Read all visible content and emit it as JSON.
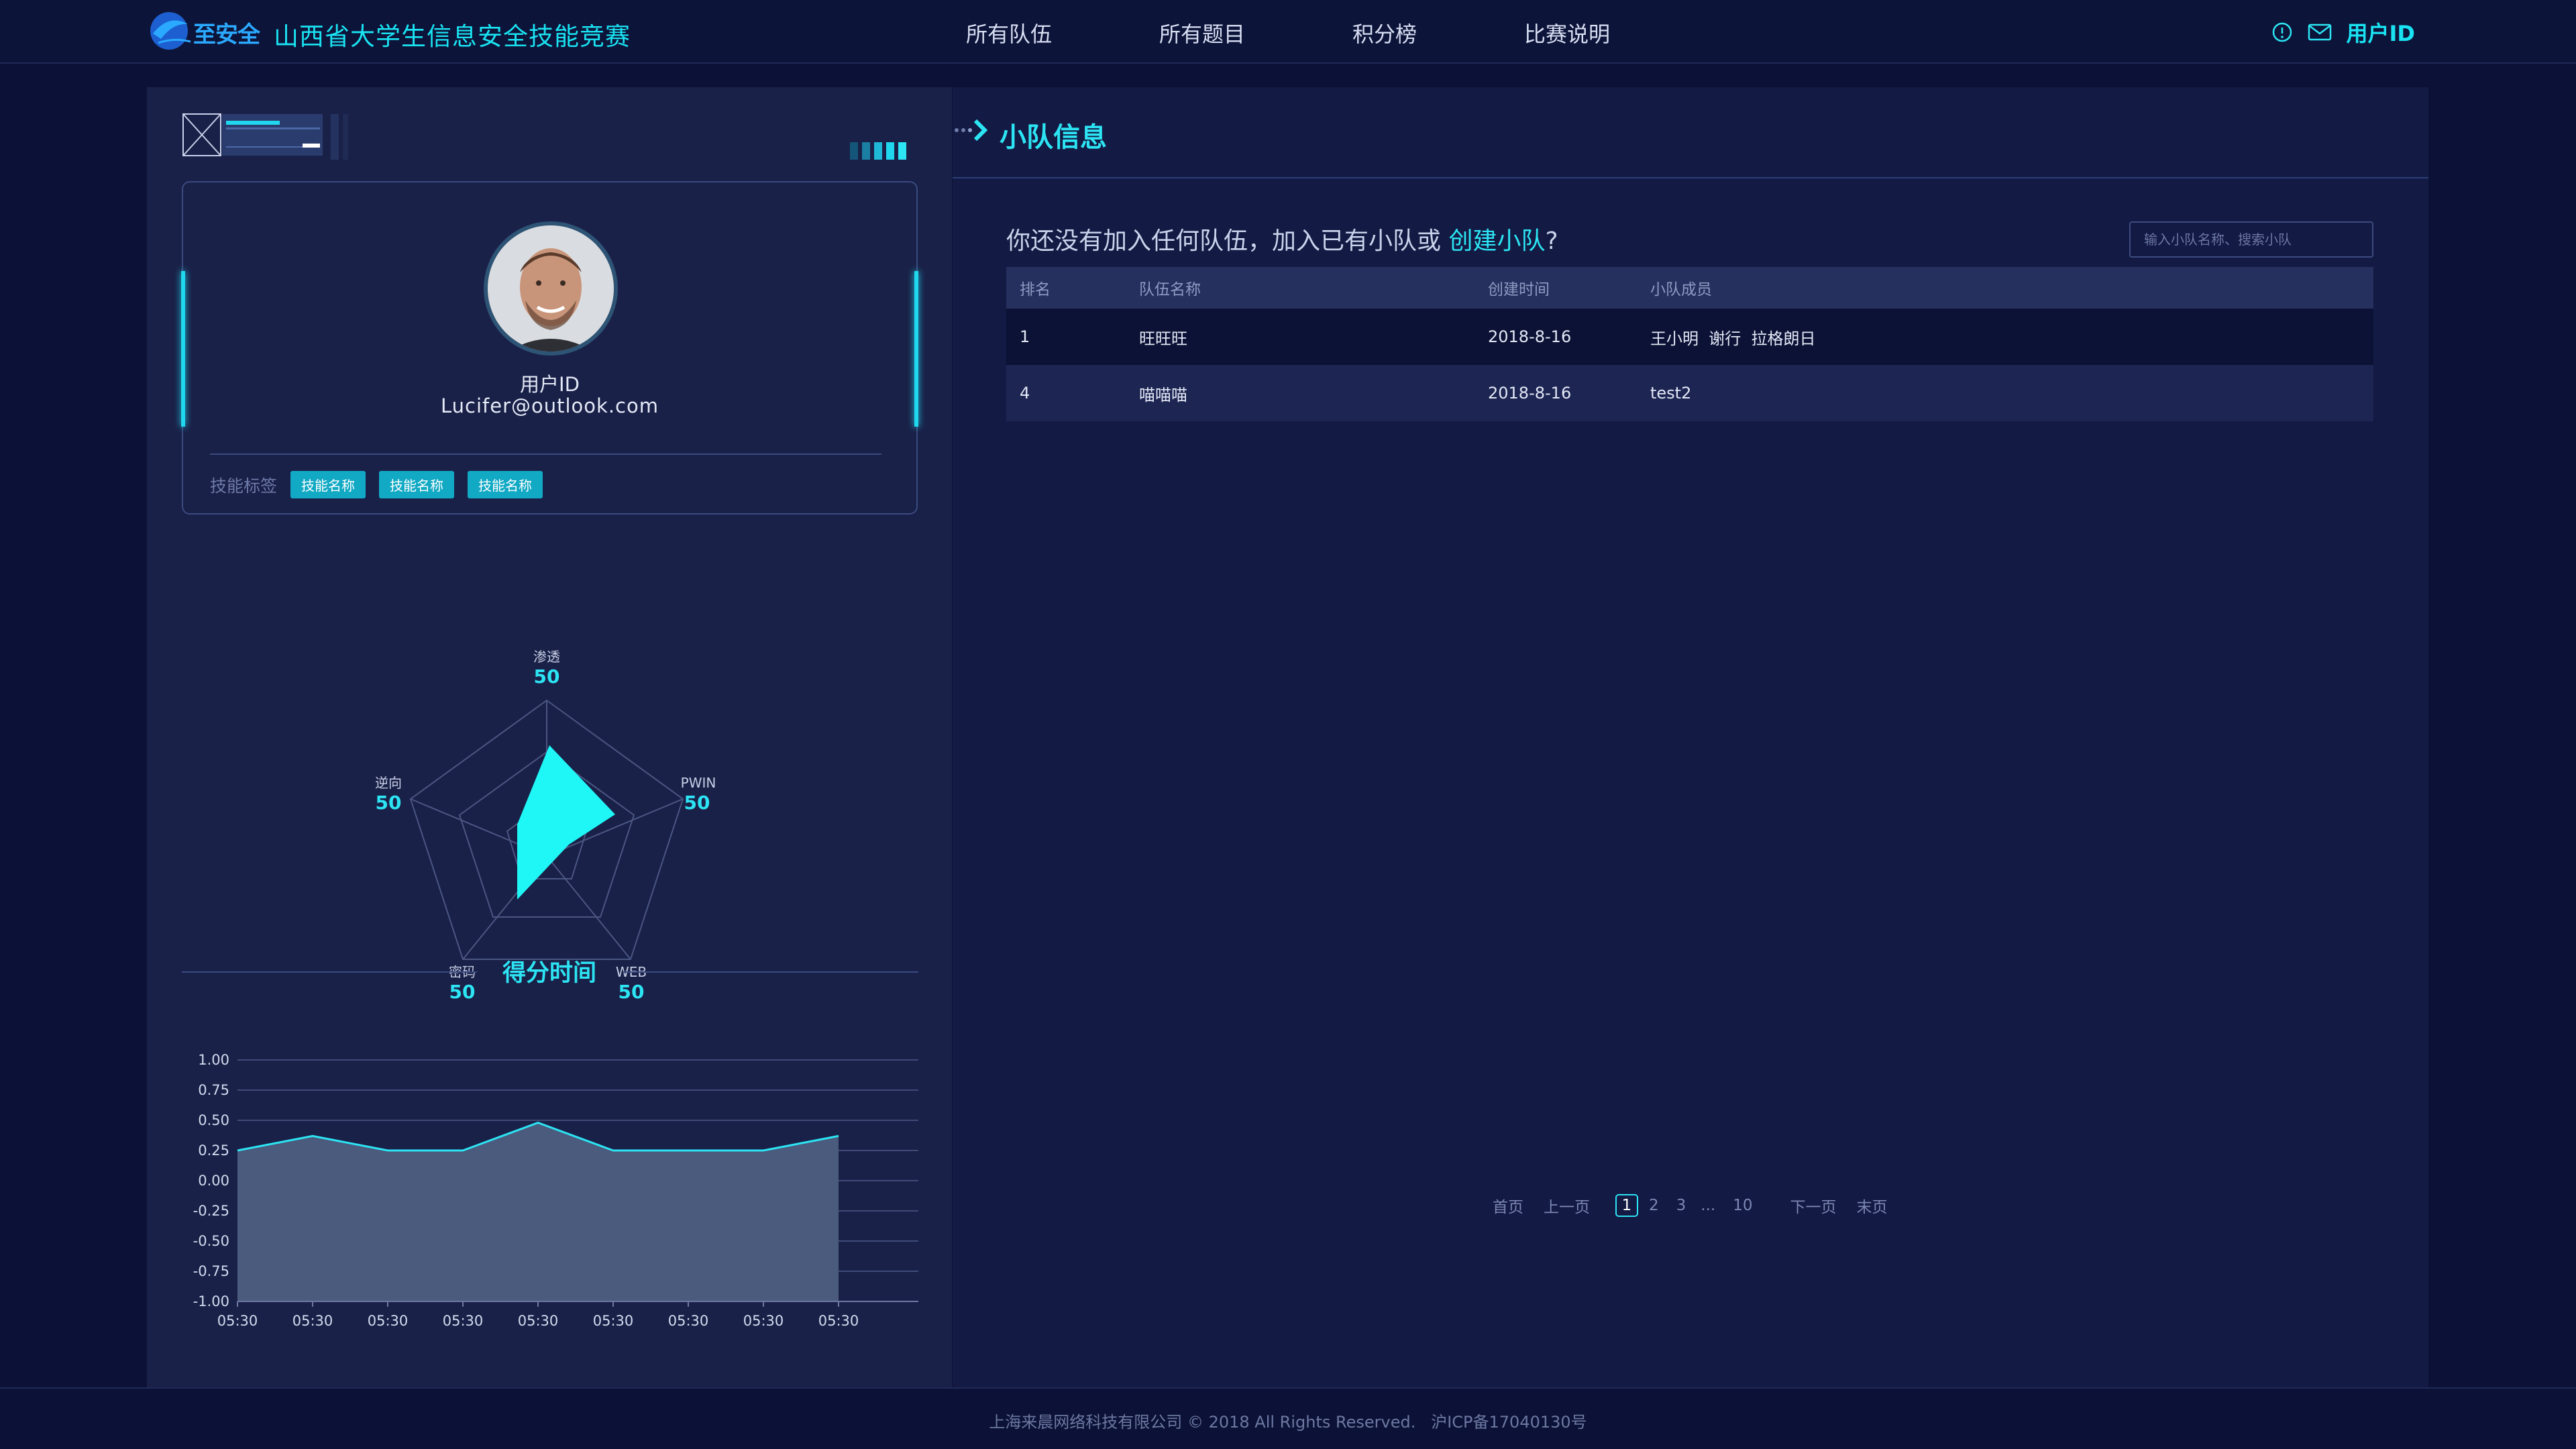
{
  "header": {
    "logo_text": "至安全",
    "site_title": "山西省大学生信息安全技能竞赛",
    "nav": [
      "所有队伍",
      "所有题目",
      "积分榜",
      "比赛说明"
    ],
    "user_label": "用户ID",
    "icons": [
      "info-icon",
      "mail-icon"
    ]
  },
  "profile": {
    "user_id": "用户ID",
    "email": "Lucifer@outlook.com",
    "skill_label": "技能标签",
    "skill_tags": [
      "技能名称",
      "技能名称",
      "技能名称"
    ]
  },
  "radar": {
    "axes": [
      {
        "label": "渗透",
        "value": "50"
      },
      {
        "label": "PWIN",
        "value": "50"
      },
      {
        "label": "WEB",
        "value": "50"
      },
      {
        "label": "密码",
        "value": "50"
      },
      {
        "label": "逆向",
        "value": "50"
      }
    ]
  },
  "score_time": {
    "title": "得分时间"
  },
  "chart_data": {
    "type": "area",
    "title": "",
    "x": [
      "05:30",
      "05:30",
      "05:30",
      "05:30",
      "05:30",
      "05:30",
      "05:30",
      "05:30",
      "05:30"
    ],
    "series": [
      {
        "values": [
          0.25,
          0.37,
          0.25,
          0.25,
          0.48,
          0.25,
          0.25,
          0.25,
          0.37
        ]
      }
    ],
    "yticks": [
      "1.00",
      "0.75",
      "0.50",
      "0.25",
      "0.00",
      "-0.25",
      "-0.50",
      "-0.75",
      "-1.00"
    ],
    "ylim": [
      -1.0,
      1.0
    ],
    "grid": true,
    "colors": {
      "line": "#2ce4f3",
      "fill": "#4a5b7e"
    }
  },
  "team_section": {
    "title": "小队信息",
    "notice_prefix": "你还没有加入任何队伍，加入已有小队或 ",
    "notice_link": "创建小队",
    "notice_suffix": "?",
    "search_placeholder": "输入小队名称、搜索小队",
    "columns": [
      "排名",
      "队伍名称",
      "创建时间",
      "小队成员"
    ],
    "rows": [
      {
        "rank": "1",
        "name": "旺旺旺",
        "created": "2018-8-16",
        "members": "王小明  谢行  拉格朗日"
      },
      {
        "rank": "4",
        "name": "喵喵喵",
        "created": "2018-8-16",
        "members": "test2"
      }
    ]
  },
  "pagination": {
    "first": "首页",
    "prev": "上一页",
    "pages": [
      "1",
      "2",
      "3"
    ],
    "ellipsis": "...",
    "last_page": "10",
    "next": "下一页",
    "end": "末页"
  },
  "footer": {
    "text": "上海来晨网络科技有限公司 © 2018 All Rights Reserved.   沪ICP备17040130号"
  },
  "colors": {
    "accent": "#2ce4f3",
    "background": "#0c1237",
    "panel": "#1a2148"
  }
}
